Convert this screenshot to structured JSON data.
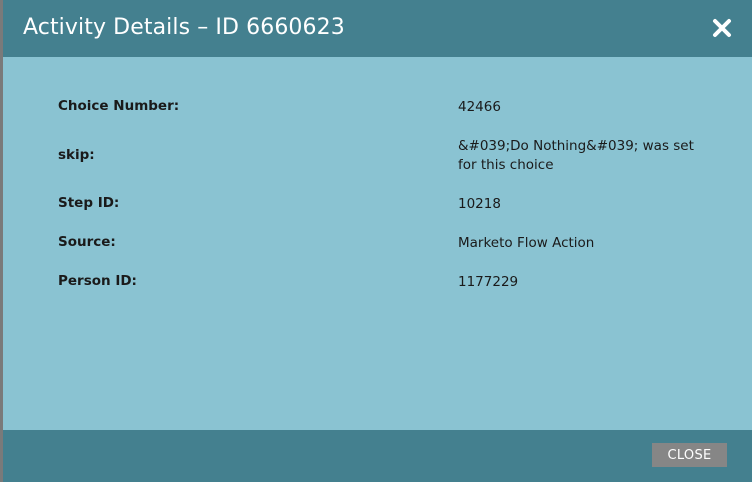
{
  "dialog": {
    "title": "Activity Details – ID 6660623",
    "close_icon": "close-x-icon",
    "close_button_label": "CLOSE"
  },
  "details": [
    {
      "label": "Choice Number:",
      "value": "42466"
    },
    {
      "label": "skip:",
      "value": "&#039;Do Nothing&#039; was set for this choice"
    },
    {
      "label": "Step ID:",
      "value": "10218"
    },
    {
      "label": "Source:",
      "value": "Marketo Flow Action"
    },
    {
      "label": "Person ID:",
      "value": "1177229"
    }
  ],
  "colors": {
    "header": "#44808f",
    "body": "#8ac3d2",
    "button": "#868686"
  }
}
